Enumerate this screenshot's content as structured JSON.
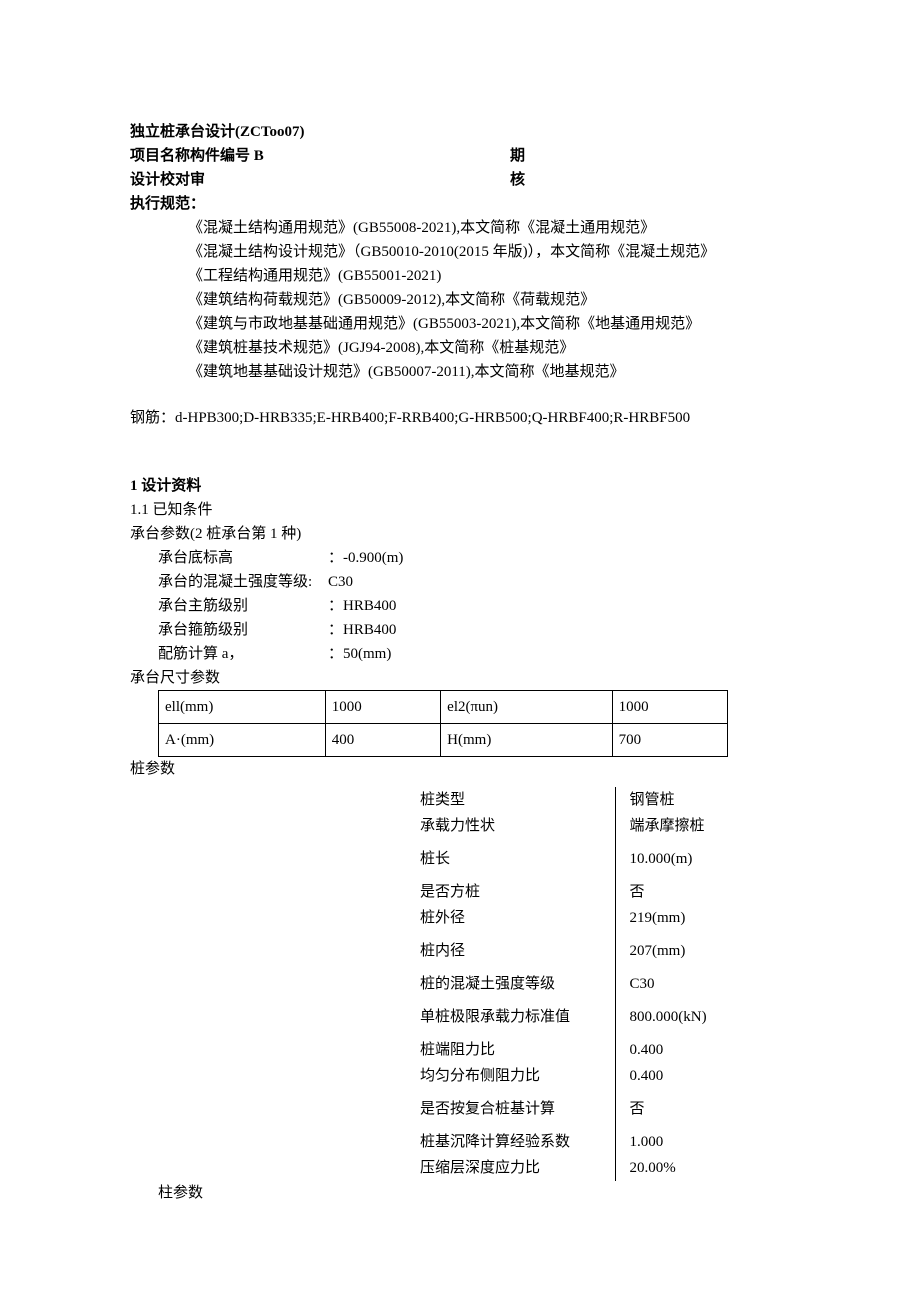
{
  "title": "独立桩承台设计(ZCToo07)",
  "header": {
    "line2_left": "项目名称构件编号 B",
    "line2_right": "期",
    "line3_left": "设计校对审",
    "line3_right": "核"
  },
  "specs_title": "执行规范：",
  "specs": [
    "《混凝土结构通用规范》(GB55008-2021),本文简称《混凝土通用规范》",
    "《混凝土结构设计规范》（GB50010-2010(2015 年版)），本文简称《混凝土规范》",
    "《工程结构通用规范》(GB55001-2021)",
    "《建筑结构荷载规范》(GB50009-2012),本文简称《荷载规范》",
    "《建筑与市政地基基础通用规范》(GB55003-2021),本文简称《地基通用规范》",
    "《建筑桩基技术规范》(JGJ94-2008),本文简称《桩基规范》",
    "《建筑地基基础设计规范》(GB50007-2011),本文简称《地基规范》"
  ],
  "rebar": "钢筋：d-HPB300;D-HRB335;E-HRB400;F-RRB400;G-HRB500;Q-HRBF400;R-HRBF500",
  "section1": {
    "title": "1 设计资料",
    "sub": "1.1 已知条件",
    "cap_title": "承台参数(2 桩承台第 1 种)",
    "cap": [
      {
        "label": "承台底标高",
        "value": "：-0.900(m)"
      },
      {
        "label": "承台的混凝土强度等级:",
        "value": "C30"
      },
      {
        "label": "承台主筋级别",
        "value": "：HRB400"
      },
      {
        "label": "承台箍筋级别",
        "value": "：HRB400"
      },
      {
        "label": "配筋计算 a，",
        "value": "：50(mm)"
      }
    ],
    "dim_title": "承台尺寸参数",
    "dim_table": {
      "r1": [
        "ell(mm)",
        "1000",
        "el2(πun)",
        "1000"
      ],
      "r2": [
        "A·(mm)",
        "400",
        "H(mm)",
        "700"
      ]
    },
    "pile_title": "桩参数",
    "pile": [
      {
        "label": "桩类型",
        "value": "钢管桩",
        "gap": false
      },
      {
        "label": "承载力性状",
        "value": "端承摩擦桩",
        "gap": false
      },
      {
        "label": "桩长",
        "value": "10.000(m)",
        "gap": true
      },
      {
        "label": "是否方桩",
        "value": "否",
        "gap": true
      },
      {
        "label": "桩外径",
        "value": "219(mm)",
        "gap": false
      },
      {
        "label": "桩内径",
        "value": "207(mm)",
        "gap": true
      },
      {
        "label": "桩的混凝土强度等级",
        "value": "C30",
        "gap": true
      },
      {
        "label": "单桩极限承载力标准值",
        "value": "800.000(kN)",
        "gap": true
      },
      {
        "label": "桩端阻力比",
        "value": "0.400",
        "gap": true
      },
      {
        "label": "均匀分布侧阻力比",
        "value": "0.400",
        "gap": false
      },
      {
        "label": "是否按复合桩基计算",
        "value": "否",
        "gap": true
      },
      {
        "label": "桩基沉降计算经验系数",
        "value": "1.000",
        "gap": true
      },
      {
        "label": "压缩层深度应力比",
        "value": "20.00%",
        "gap": false
      }
    ],
    "col_title": "柱参数"
  }
}
